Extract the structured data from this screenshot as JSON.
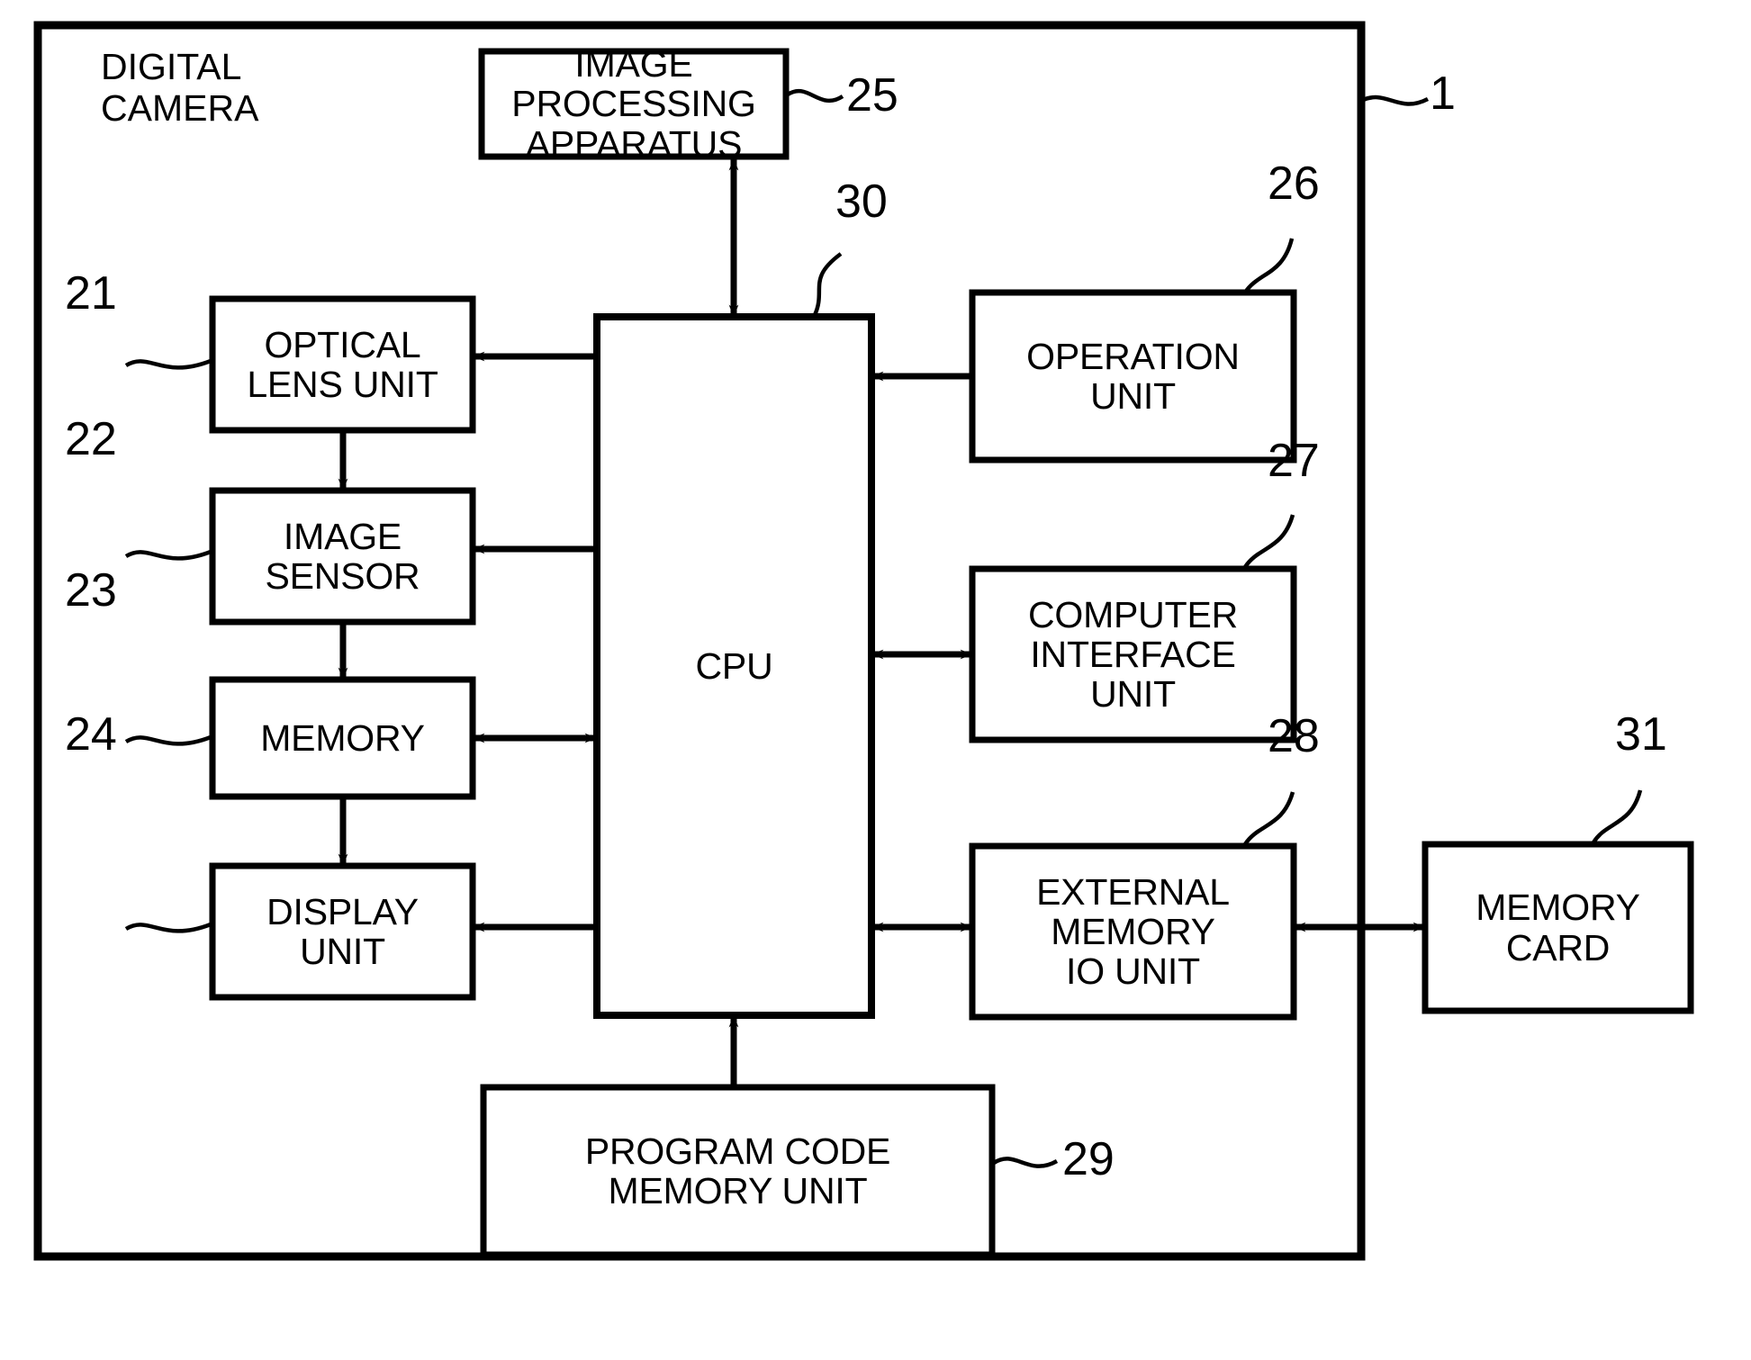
{
  "figure": {
    "system_label": "DIGITAL\nCAMERA",
    "system_ref": "1"
  },
  "blocks": [
    {
      "key": "image_processing_apparatus",
      "label": "IMAGE PROCESSING\nAPPARATUS",
      "ref": "25"
    },
    {
      "key": "optical_lens_unit",
      "label": "OPTICAL\nLENS UNIT",
      "ref": "21"
    },
    {
      "key": "image_sensor",
      "label": "IMAGE\nSENSOR",
      "ref": "22"
    },
    {
      "key": "memory",
      "label": "MEMORY",
      "ref": "23"
    },
    {
      "key": "display_unit",
      "label": "DISPLAY\nUNIT",
      "ref": "24"
    },
    {
      "key": "cpu",
      "label": "CPU",
      "ref": "30"
    },
    {
      "key": "operation_unit",
      "label": "OPERATION\nUNIT",
      "ref": "26"
    },
    {
      "key": "computer_interface_unit",
      "label": "COMPUTER\nINTERFACE\nUNIT",
      "ref": "27"
    },
    {
      "key": "external_memory_io_unit",
      "label": "EXTERNAL\nMEMORY\nIO UNIT",
      "ref": "28"
    },
    {
      "key": "program_code_memory_unit",
      "label": "PROGRAM CODE\nMEMORY UNIT",
      "ref": "29"
    },
    {
      "key": "memory_card",
      "label": "MEMORY\nCARD",
      "ref": "31"
    }
  ],
  "colors": {
    "ink": "#000000",
    "paper": "#ffffff"
  }
}
